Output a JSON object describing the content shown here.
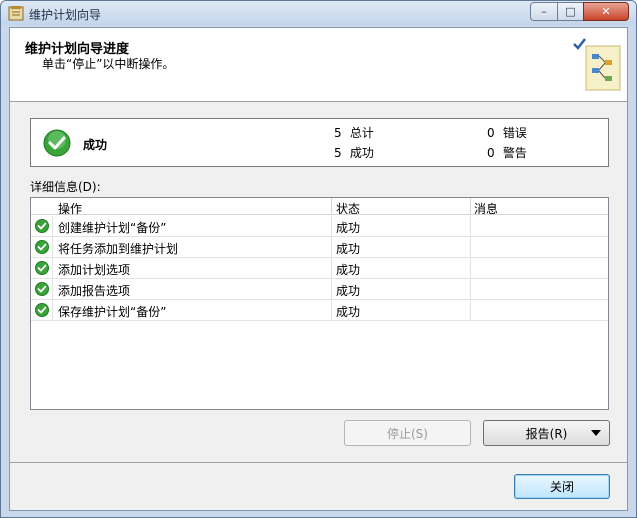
{
  "window": {
    "title": "维护计划向导"
  },
  "title_controls": {
    "minimize": "–",
    "maximize": "□",
    "close": "✕"
  },
  "header": {
    "title": "维护计划向导进度",
    "subtitle": "单击“停止”以中断操作。"
  },
  "summary": {
    "status": "成功",
    "total_count": "5",
    "total_label": "总计",
    "success_count": "5",
    "success_label": "成功",
    "error_count": "0",
    "error_label": "错误",
    "warning_count": "0",
    "warning_label": "警告"
  },
  "details": {
    "label": "详细信息(D):",
    "columns": {
      "action": "操作",
      "status": "状态",
      "message": "消息"
    },
    "rows": [
      {
        "action": "创建维护计划“备份”",
        "status": "成功",
        "message": ""
      },
      {
        "action": "将任务添加到维护计划",
        "status": "成功",
        "message": ""
      },
      {
        "action": "添加计划选项",
        "status": "成功",
        "message": ""
      },
      {
        "action": "添加报告选项",
        "status": "成功",
        "message": ""
      },
      {
        "action": "保存维护计划“备份”",
        "status": "成功",
        "message": ""
      }
    ]
  },
  "buttons": {
    "stop": "停止(S)",
    "report": "报告(R)",
    "close": "关闭"
  },
  "colors": {
    "success_green": "#3aa33a",
    "title_bar": "#c4d5ea",
    "close_button": "#c7442b"
  },
  "icons": {
    "app": "wizard-app-icon",
    "header": "maintenance-plan-graphic",
    "status": "success-check-icon"
  }
}
